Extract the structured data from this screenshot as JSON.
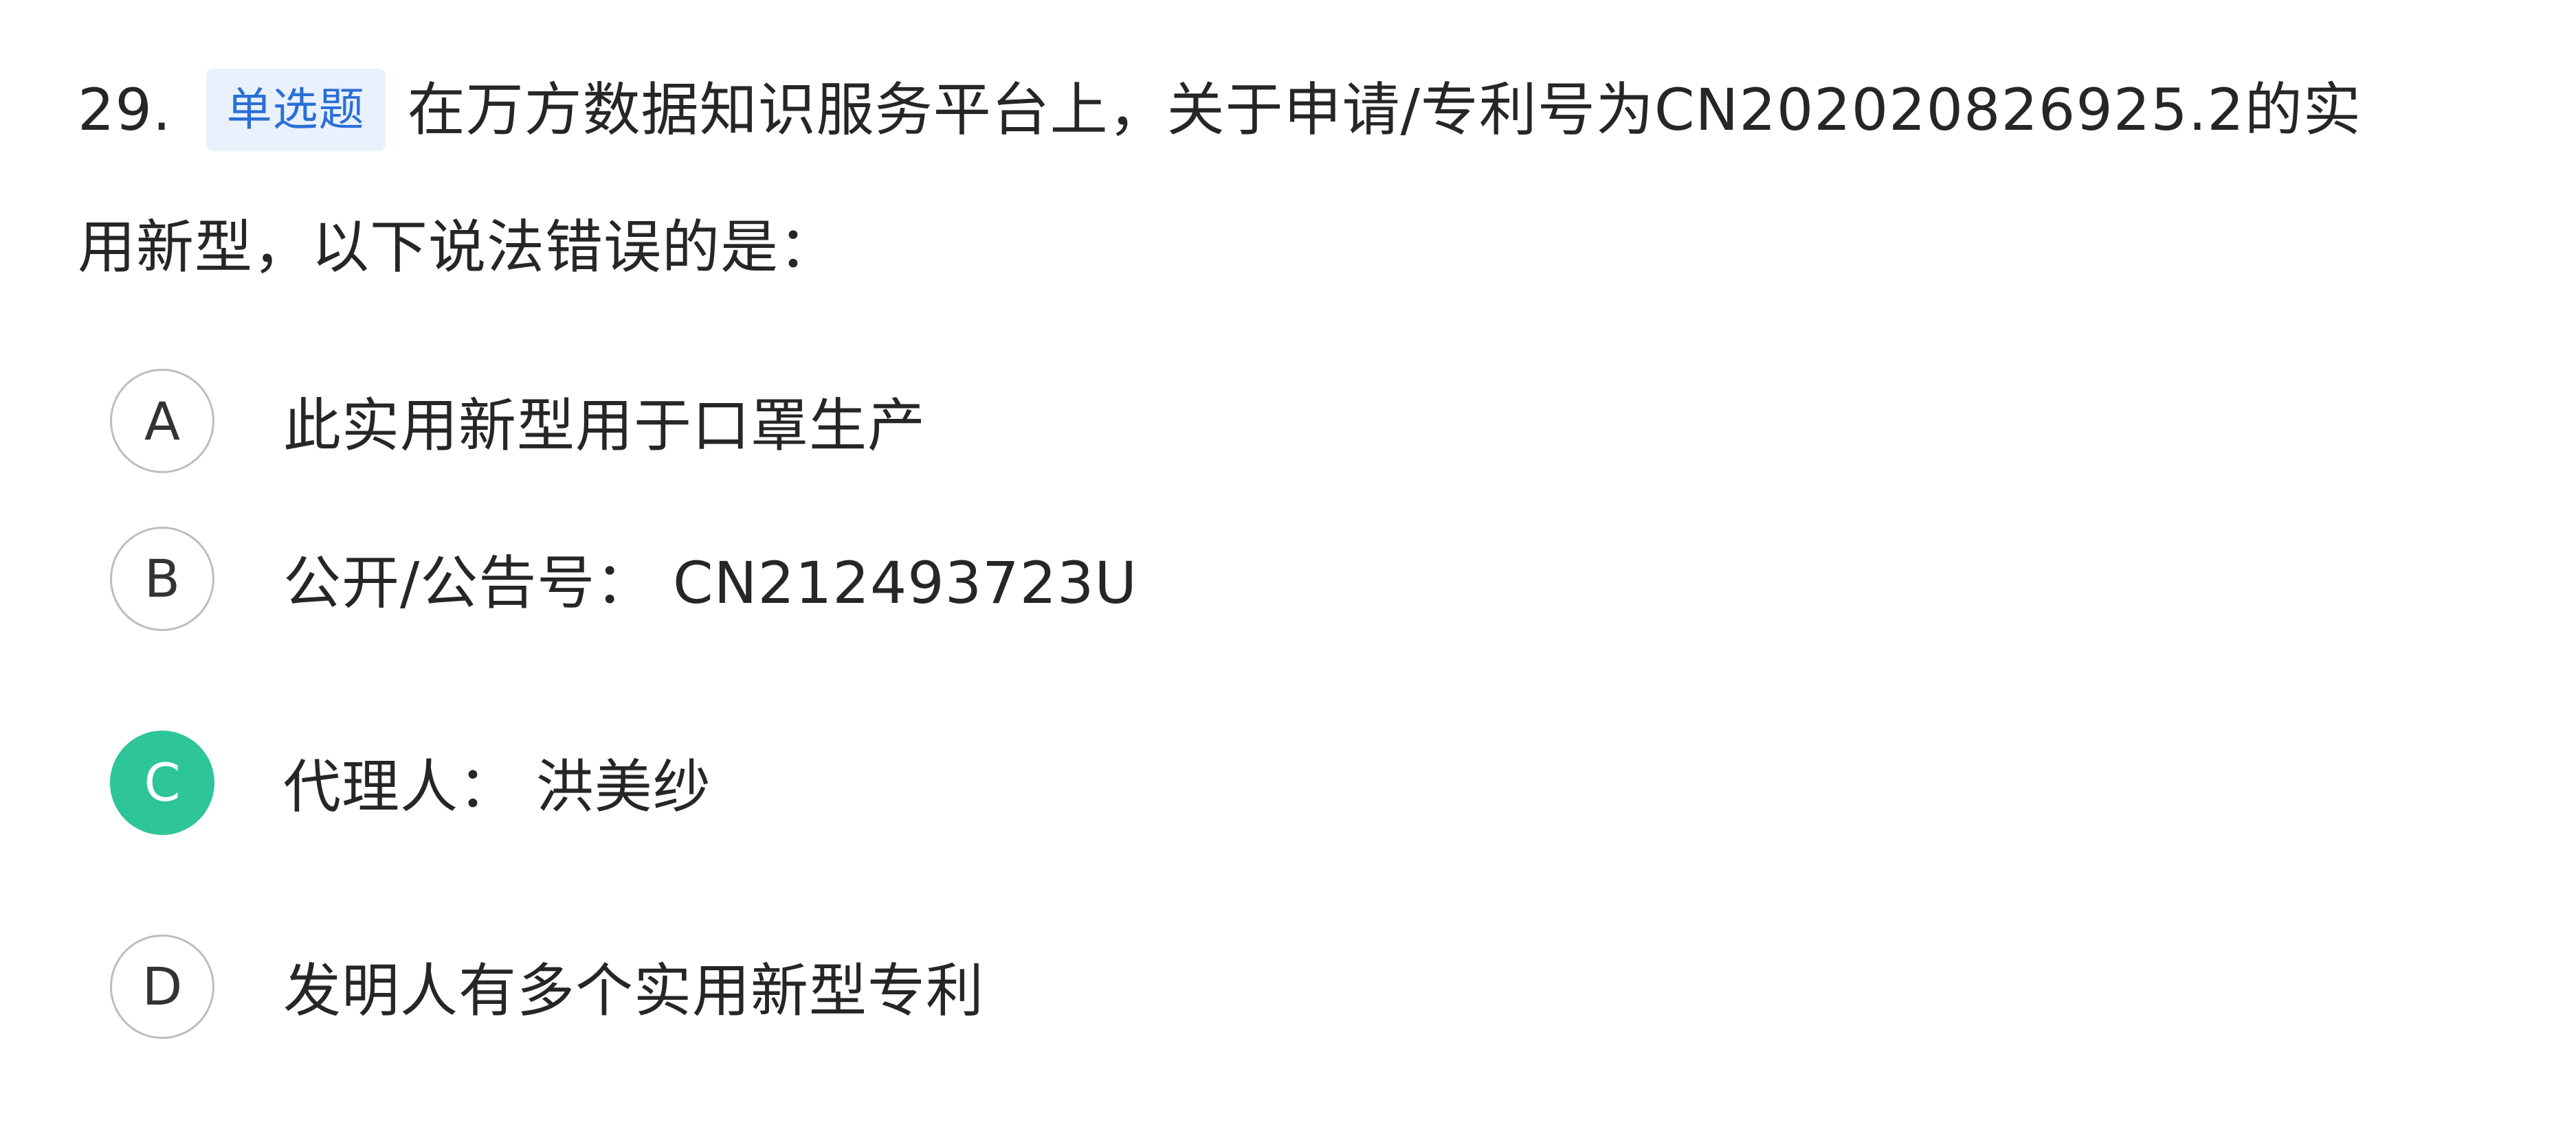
{
  "question": {
    "number": "29.",
    "type_tag": "单选题",
    "text_line1": "在万方数据知识服务平台上，关于申请/专利号为CN202020826925.2的实",
    "text_line2": "用新型，以下说法错误的是："
  },
  "options": [
    {
      "key": "A",
      "text": "此实用新型用于口罩生产",
      "selected": false
    },
    {
      "key": "B",
      "text": "公开/公告号： CN212493723U",
      "selected": false
    },
    {
      "key": "C",
      "text": "代理人： 洪美纱",
      "selected": true
    },
    {
      "key": "D",
      "text": "发明人有多个实用新型专利",
      "selected": false
    }
  ],
  "colors": {
    "selected": "#2ec598",
    "tag_bg": "#e8f1fc",
    "tag_text": "#2a6fd6"
  }
}
